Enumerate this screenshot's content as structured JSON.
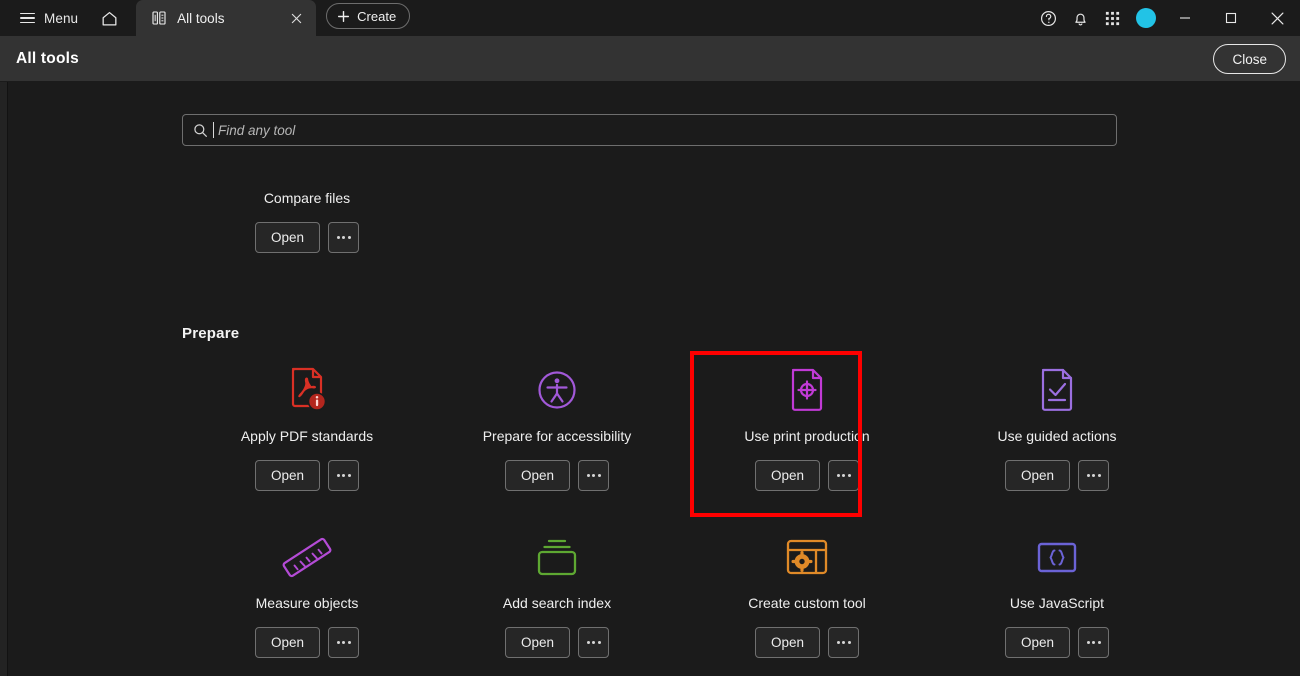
{
  "titlebar": {
    "menu_label": "Menu",
    "menu_icon": "hamburger-icon",
    "home_icon": "home-icon",
    "tab": {
      "label": "All tools",
      "icon": "all-tools-panel-icon",
      "close_icon": "close-icon"
    },
    "create_label": "Create",
    "create_icon": "plus-icon",
    "right_icons": [
      {
        "name": "help-icon",
        "title": "Help"
      },
      {
        "name": "bell-icon",
        "title": "Notifications"
      },
      {
        "name": "app-grid-icon",
        "title": "Apps"
      }
    ],
    "avatar": {
      "name": "avatar",
      "color": "#22c3e6"
    },
    "window_controls": [
      {
        "name": "minimize-button",
        "glyph": "minimize-icon"
      },
      {
        "name": "maximize-button",
        "glyph": "maximize-icon"
      },
      {
        "name": "close-window-button",
        "glyph": "close-icon"
      }
    ]
  },
  "header": {
    "title": "All tools",
    "close_label": "Close"
  },
  "search": {
    "placeholder": "Find any tool",
    "value": "",
    "icon": "search-icon"
  },
  "actions": {
    "open_label": "Open",
    "more_label": "More options",
    "more_icon": "ellipsis-icon"
  },
  "scrolled_row": {
    "tools": [
      {
        "label": "Compare files",
        "icon": "compare-files-icon",
        "color": "#e0218a"
      }
    ]
  },
  "sections": [
    {
      "title": "Prepare",
      "rows": [
        [
          {
            "label": "Apply PDF standards",
            "icon": "pdf-standards-icon",
            "color": "#d93025",
            "highlighted": false
          },
          {
            "label": "Prepare for accessibility",
            "icon": "accessibility-icon",
            "color": "#a259d9",
            "highlighted": false
          },
          {
            "label": "Use print production",
            "icon": "print-production-icon",
            "color": "#c13ad6",
            "highlighted": true
          },
          {
            "label": "Use guided actions",
            "icon": "guided-actions-icon",
            "color": "#9b6fe0",
            "highlighted": false
          }
        ],
        [
          {
            "label": "Measure objects",
            "icon": "ruler-icon",
            "color": "#b44bd6",
            "highlighted": false
          },
          {
            "label": "Add search index",
            "icon": "search-index-icon",
            "color": "#5ea832",
            "highlighted": false
          },
          {
            "label": "Create custom tool",
            "icon": "custom-tool-icon",
            "color": "#e08a28",
            "highlighted": false
          },
          {
            "label": "Use JavaScript",
            "icon": "javascript-braces-icon",
            "color": "#6b63d6",
            "highlighted": false
          }
        ]
      ]
    }
  ],
  "annotation": {
    "name": "highlight-box",
    "color": "#fe0000",
    "target": "Use print production"
  }
}
